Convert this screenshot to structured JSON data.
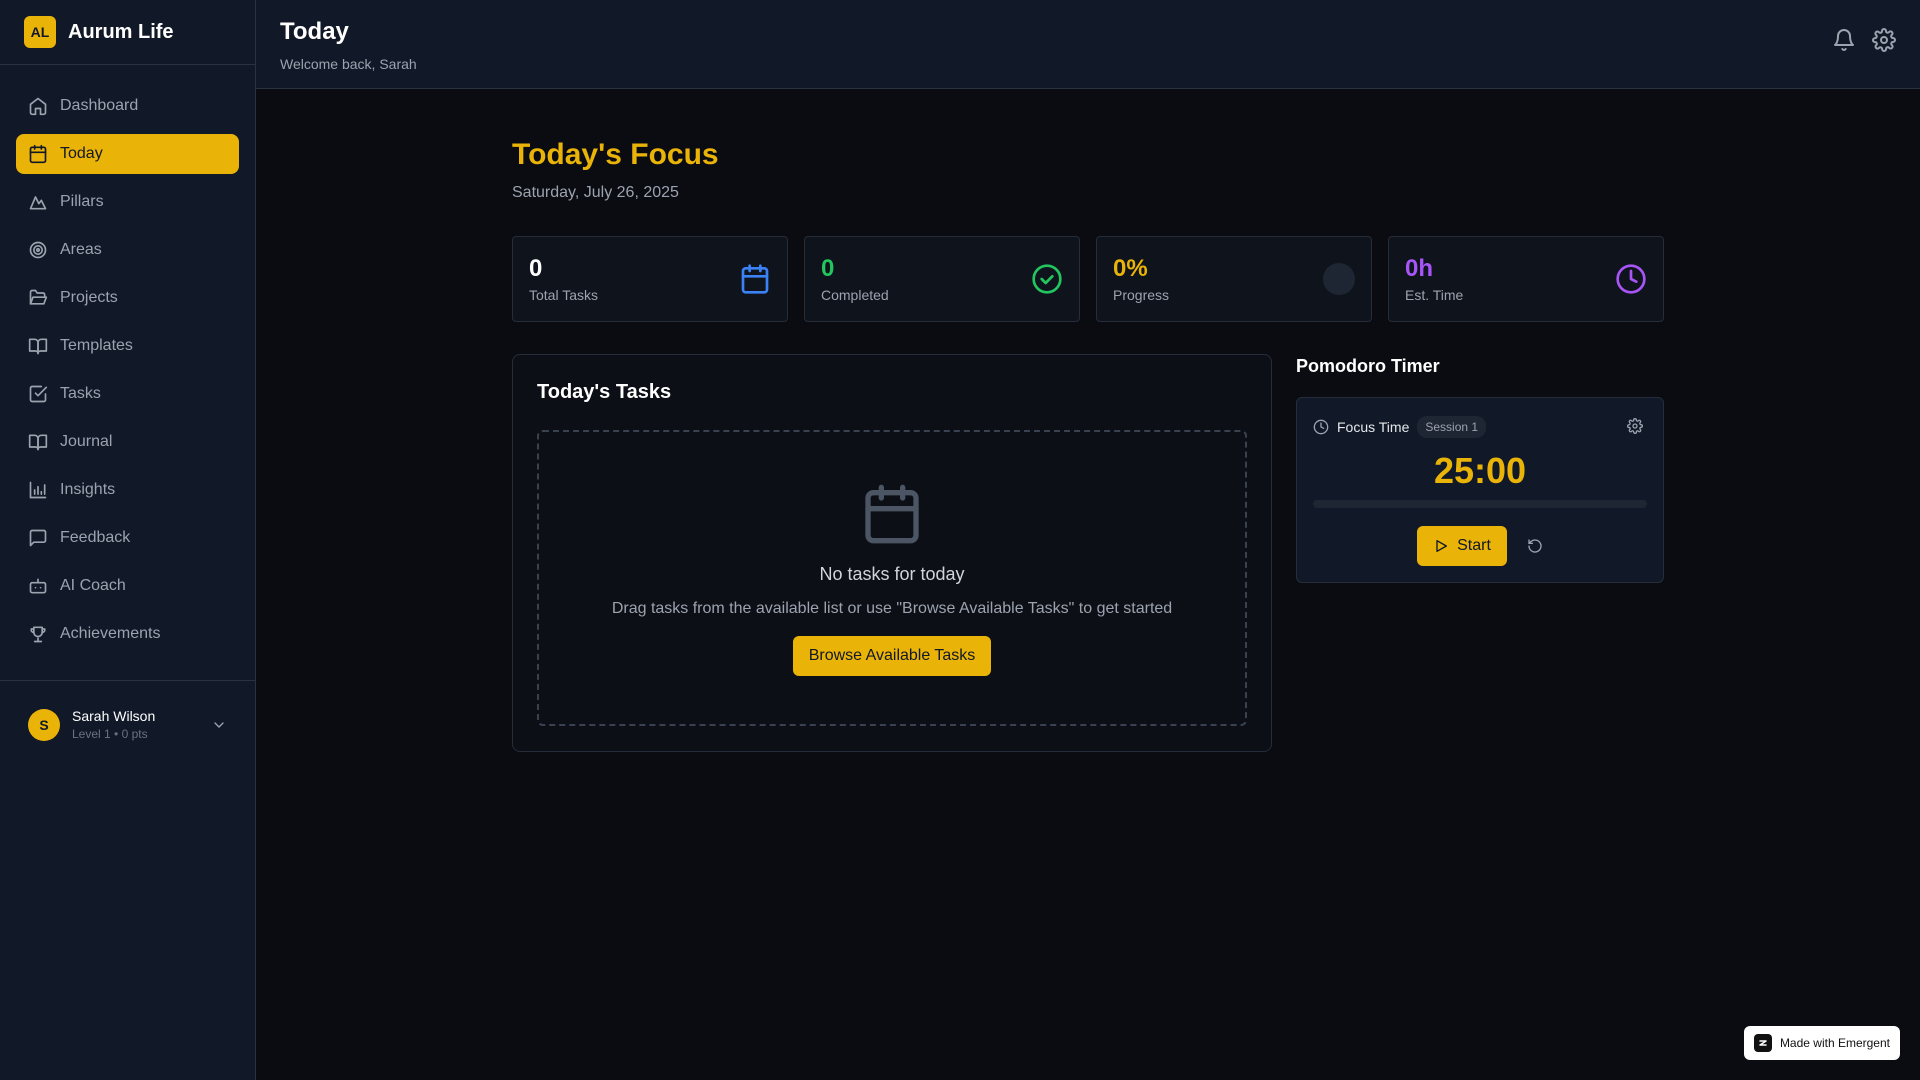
{
  "app": {
    "logo_text": "AL",
    "name": "Aurum Life"
  },
  "sidebar": {
    "items": [
      {
        "label": "Dashboard",
        "icon": "home-icon",
        "active": false
      },
      {
        "label": "Today",
        "icon": "calendar-icon",
        "active": true
      },
      {
        "label": "Pillars",
        "icon": "mountain-icon",
        "active": false
      },
      {
        "label": "Areas",
        "icon": "target-icon",
        "active": false
      },
      {
        "label": "Projects",
        "icon": "folder-open-icon",
        "active": false
      },
      {
        "label": "Templates",
        "icon": "book-open-icon",
        "active": false
      },
      {
        "label": "Tasks",
        "icon": "check-square-icon",
        "active": false
      },
      {
        "label": "Journal",
        "icon": "book-icon",
        "active": false
      },
      {
        "label": "Insights",
        "icon": "bar-chart-icon",
        "active": false
      },
      {
        "label": "Feedback",
        "icon": "message-icon",
        "active": false
      },
      {
        "label": "AI Coach",
        "icon": "bot-icon",
        "active": false
      },
      {
        "label": "Achievements",
        "icon": "trophy-icon",
        "active": false
      }
    ],
    "user": {
      "initial": "S",
      "name": "Sarah Wilson",
      "meta": "Level 1 • 0 pts"
    }
  },
  "header": {
    "title": "Today",
    "subtitle": "Welcome back, Sarah"
  },
  "focus": {
    "title": "Today's Focus",
    "date": "Saturday, July 26, 2025"
  },
  "stats": [
    {
      "value": "0",
      "label": "Total Tasks",
      "color": "#ffffff",
      "icon": "calendar-icon"
    },
    {
      "value": "0",
      "label": "Completed",
      "color": "#22c55e",
      "icon": "check-circle-icon"
    },
    {
      "value": "0%",
      "label": "Progress",
      "color": "#eab308",
      "icon": "progress-circle-icon"
    },
    {
      "value": "0h",
      "label": "Est. Time",
      "color": "#a855f7",
      "icon": "clock-icon"
    }
  ],
  "tasks": {
    "title": "Today's Tasks",
    "empty_title": "No tasks for today",
    "empty_desc": "Drag tasks from the available list or use \"Browse Available Tasks\" to get started",
    "browse_label": "Browse Available Tasks"
  },
  "pomodoro": {
    "title": "Pomodoro Timer",
    "mode": "Focus Time",
    "session": "Session 1",
    "time": "25:00",
    "progress": 0,
    "start_label": "Start"
  },
  "footer_badge": "Made with Emergent",
  "colors": {
    "accent": "#eab308",
    "bg": "#0a0c12",
    "panel": "#111827"
  }
}
